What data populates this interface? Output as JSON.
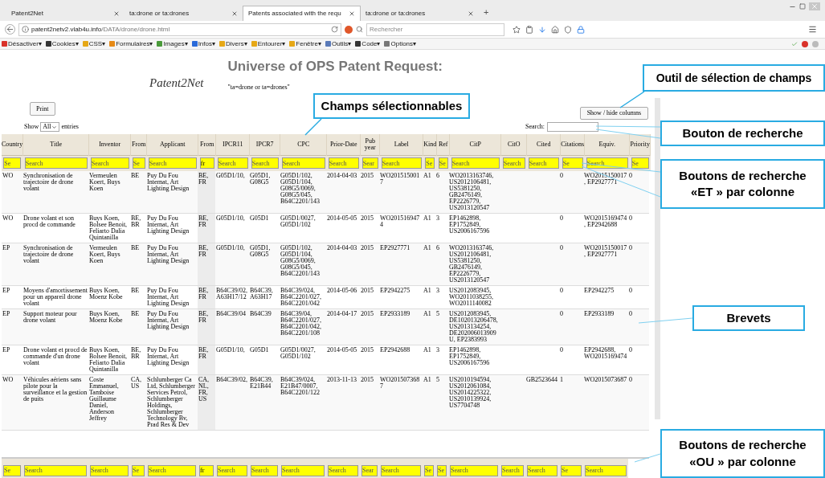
{
  "browser": {
    "tabs": [
      {
        "label": "Patent2Net",
        "selected": false
      },
      {
        "label": "ta:drone or ta:drones",
        "selected": false
      },
      {
        "label": "Patents associated with the requ",
        "selected": true
      },
      {
        "label": "ta:drone or ta:drones",
        "selected": false
      }
    ],
    "new_tab": "+",
    "url_host": "patent2netv2.vlab4u.info",
    "url_path": "/DATA/drone/drone.html",
    "search_placeholder": "Rechercher",
    "toolbar": [
      "Désactiver▾",
      "Cookies▾",
      "CSS▾",
      "Formulaires▾",
      "Images▾",
      "Infos▾",
      "Divers▾",
      "Entourer▾",
      "Fenêtre▾",
      "Outils▾",
      "Code▾",
      "Options▾"
    ]
  },
  "page": {
    "logo": "Patent2Net",
    "title": "Universe of OPS Patent Request:",
    "query": "\"ta=drone or ta=drones\"",
    "print": "Print",
    "columns_button": "Show / hide columns",
    "show_label": "Show",
    "show_value": "All",
    "entries_label": "entries",
    "search_label": "Search:"
  },
  "table": {
    "columns": [
      "Country",
      "Title",
      "Inventor",
      "From",
      "Applicant",
      "From",
      "IPCR11",
      "IPCR7",
      "CPC",
      "Prior-Date",
      "Pub year",
      "Label",
      "Kind",
      "Ref",
      "CitP",
      "CitO",
      "Cited",
      "Citations",
      "Equiv.",
      "Priority"
    ],
    "filters": [
      {
        "placeholder": "Se"
      },
      {
        "placeholder": "Search"
      },
      {
        "placeholder": "Search"
      },
      {
        "placeholder": "Se"
      },
      {
        "placeholder": "Search"
      },
      {
        "value": "fr"
      },
      {
        "placeholder": "Search"
      },
      {
        "placeholder": "Search"
      },
      {
        "placeholder": "Search"
      },
      {
        "placeholder": "Search"
      },
      {
        "placeholder": "Sear"
      },
      {
        "placeholder": "Search"
      },
      {
        "placeholder": "Se"
      },
      {
        "placeholder": "Se"
      },
      {
        "placeholder": "Search"
      },
      {
        "placeholder": "Search"
      },
      {
        "placeholder": "Search"
      },
      {
        "placeholder": "Se"
      },
      {
        "placeholder": "Search"
      },
      {
        "placeholder": "Se"
      }
    ],
    "rows": [
      [
        "WO",
        "Synchronisation de trajectoire de drone volant",
        "Vermeulen Koert, Buys Koen",
        "BE",
        "Puy Du Fou Internat, Art Lighting Design",
        "BE, FR",
        "G05D1/10,",
        "G05D1, G08G5",
        "G05D1/102, G05D1/104, G08G5/0069, G08G5/045, B64C2201/143",
        "2014-04-03",
        "2015",
        "WO2015150017",
        "A1",
        "6",
        "WO2013163746, US2012106481, US5381250, GB2476149, EP2226779, US2013120547",
        null,
        null,
        "0",
        "WO2015150017, EP2927771",
        "0"
      ],
      [
        "WO",
        "Drone volant et son procd de commande",
        "Buys Koen, Bolsee Benoit, Feliarto Dalia Quintanilla",
        "BE, BR",
        "Puy Du Fou Internat, Art Lighting Design",
        "BE, FR",
        "G05D1/10,",
        "G05D1",
        "G05D1/0027, G05D1/102",
        "2014-05-05",
        "2015",
        "WO2015169474",
        "A1",
        "3",
        "EP1462898, EP1752849, US2006167596",
        null,
        null,
        "0",
        "WO2015169474, EP2942688",
        "0"
      ],
      [
        "EP",
        "Synchronisation de trajectoire de drone volant",
        "Vermeulen Koert, Buys Koen",
        "BE",
        "Puy Du Fou Internat, Art Lighting Design",
        "BE, FR",
        "G05D1/10,",
        "G05D1, G08G5",
        "G05D1/102, G05D1/104, G08G5/0069, G08G5/045, B64C2201/143",
        "2014-04-03",
        "2015",
        "EP2927771",
        "A1",
        "6",
        "WO2013163746, US2012106481, US5381250, GB2476149, EP2226779, US2013120547",
        null,
        null,
        "0",
        "WO2015150017, EP2927771",
        "0"
      ],
      [
        "EP",
        "Moyens d'amortissement pour un appareil drone volant",
        "Buys Koen, Moenz Kobe",
        "BE",
        "Puy Du Fou Internat, Art Lighting Design",
        "BE, FR",
        "B64C39/02, A63H17/12",
        "B64C39, A63H17",
        "B64C39/024, B64C2201/027, B64C2201/042",
        "2014-05-06",
        "2015",
        "EP2942275",
        "A1",
        "3",
        "US2012083945, WO2011038255, WO2011140082",
        null,
        null,
        "0",
        "EP2942275",
        "0"
      ],
      [
        "EP",
        "Support moteur pour drone volant",
        "Buys Koen, Moenz Kobe",
        "BE",
        "Puy Du Fou Internat, Art Lighting Design",
        "BE, FR",
        "B64C39/04",
        "B64C39",
        "B64C39/04, B64C2201/027, B64C2201/042, B64C2201/108",
        "2014-04-17",
        "2015",
        "EP2933189",
        "A1",
        "5",
        "US2012083945, DE102013206478, US2013134254, DE202006013909U, EP2383993",
        null,
        null,
        "0",
        "EP2933189",
        "0"
      ],
      [
        "EP",
        "Drone volant et procd de commande d'un drone volant",
        "Buys Koen, Bolsee Benoit, Feliarto Dalia Quintanilla",
        "BE, BR",
        "Puy Du Fou Internat, Art Lighting Design",
        "BE, FR",
        "G05D1/10,",
        "G05D1",
        "G05D1/0027, G05D1/102",
        "2014-05-05",
        "2015",
        "EP2942688",
        "A1",
        "3",
        "EP1462898, EP1752849, US2006167596",
        null,
        null,
        "0",
        "EP2942688, WO2015169474",
        "0"
      ],
      [
        "WO",
        "Véhicules aériens sans pilote pour la surveillance et la gestion de puits",
        "Coste Emmanuel, Tamboise Guillaume Daniel, Anderson Jeffrey",
        "CA, US",
        "Schlumberger Ca Ltd, Schlumberger Services Petrol, Schlumberger Holdings, Schlumberger Technology Bv, Prad Res & Dev",
        "CA, NL, FR, US",
        "B64C39/02,",
        "B64C39, E21B44",
        "B64C39/024, E21B47/0007, B64C2201/122",
        "2013-11-13",
        "2015",
        "WO2015073687",
        "A1",
        "5",
        "US2010194594, US2012061084, US2014225322, US2010139924, US7704748",
        null,
        "GB2523644",
        "1",
        "WO2015073687",
        "0"
      ]
    ],
    "footer_filters": [
      {
        "placeholder": "Se"
      },
      {
        "placeholder": "Search"
      },
      {
        "placeholder": "Search"
      },
      {
        "placeholder": "Se"
      },
      {
        "placeholder": "Search"
      },
      {
        "value": "fr"
      },
      {
        "placeholder": "Search"
      },
      {
        "placeholder": "Search"
      },
      {
        "placeholder": "Search"
      },
      {
        "placeholder": "Search"
      },
      {
        "placeholder": "Sear"
      },
      {
        "placeholder": "Search"
      },
      {
        "placeholder": "Se"
      },
      {
        "placeholder": "Se"
      },
      {
        "placeholder": "Search"
      },
      {
        "placeholder": "Search"
      },
      {
        "placeholder": "Search"
      },
      {
        "placeholder": "Se"
      },
      {
        "placeholder": "Search"
      }
    ]
  },
  "callouts": [
    {
      "lines": [
        "Outil de sélection de champs"
      ]
    },
    {
      "lines": [
        "Champs sélectionnables"
      ]
    },
    {
      "lines": [
        "Bouton de recherche"
      ]
    },
    {
      "lines": [
        "Boutons de recherche",
        "«ET » par colonne"
      ]
    },
    {
      "lines": [
        "Brevets"
      ]
    },
    {
      "lines": [
        "Boutons de recherche",
        "«OU » par colonne"
      ]
    }
  ]
}
